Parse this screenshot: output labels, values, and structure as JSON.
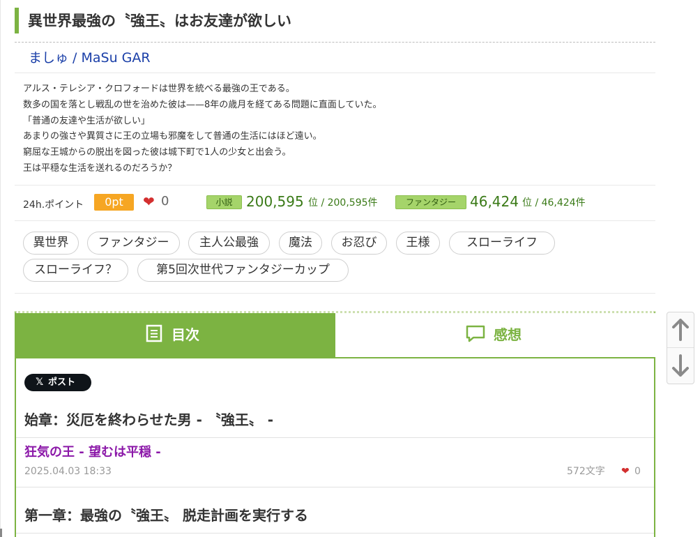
{
  "novel": {
    "title": "異世界最強の〝強王〟はお友達が欲しい",
    "author": "ましゅ / MaSu GAR",
    "synopsis": [
      "アルス・テレシア・クロフォードは世界を統べる最強の王である。",
      "数多の国を落とし戦乱の世を治めた彼は——8年の歳月を経てある問題に直面していた。",
      "「普通の友達や生活が欲しい」",
      "あまりの強さや異質さに王の立場も邪魔をして普通の生活にはほど遠い。",
      "窮屈な王城からの脱出を図った彼は城下町で1人の少女と出会う。",
      "王は平穏な生活を送れるのだろうか？"
    ]
  },
  "stats": {
    "points_label": "24h.ポイント",
    "points_value": "0pt",
    "likes": "0",
    "rank1": {
      "category": "小説",
      "rank": "200,595",
      "suffix": "位 / 200,595件"
    },
    "rank2": {
      "category": "ファンタジー",
      "rank": "46,424",
      "suffix": "位 / 46,424件"
    }
  },
  "tags": [
    "異世界",
    "ファンタジー",
    "主人公最強",
    "魔法",
    "お忍び",
    "王様",
    "スローライフ",
    "スローライフ？",
    "第5回次世代ファンタジーカップ"
  ],
  "tabs": {
    "toc": "目次",
    "impressions": "感想"
  },
  "share": {
    "post_label": "ポスト",
    "x_glyph": "𝕏"
  },
  "chapters": [
    {
      "title": "始章：災厄を終わらせた男 - 〝強王〟 -"
    },
    {
      "title": "第一章：最強の〝強王〟 脱走計画を実行する"
    }
  ],
  "episodes": [
    {
      "title": "狂気の王 - 望むは平穏 -",
      "date": "2025.04.03 18:33",
      "chars": "572文字",
      "likes": "0"
    }
  ],
  "colors": {
    "accent_green": "#7cb342",
    "points_orange": "#f6a623",
    "heart_red": "#d32f2f",
    "episode_purple": "#8b18a8",
    "author_blue": "#1a3fa8"
  },
  "icons": {
    "heart": "heart-icon",
    "toc": "document-list-icon",
    "impressions": "speech-bubble-icon",
    "scroll_up": "arrow-up-icon",
    "scroll_down": "arrow-down-icon"
  }
}
